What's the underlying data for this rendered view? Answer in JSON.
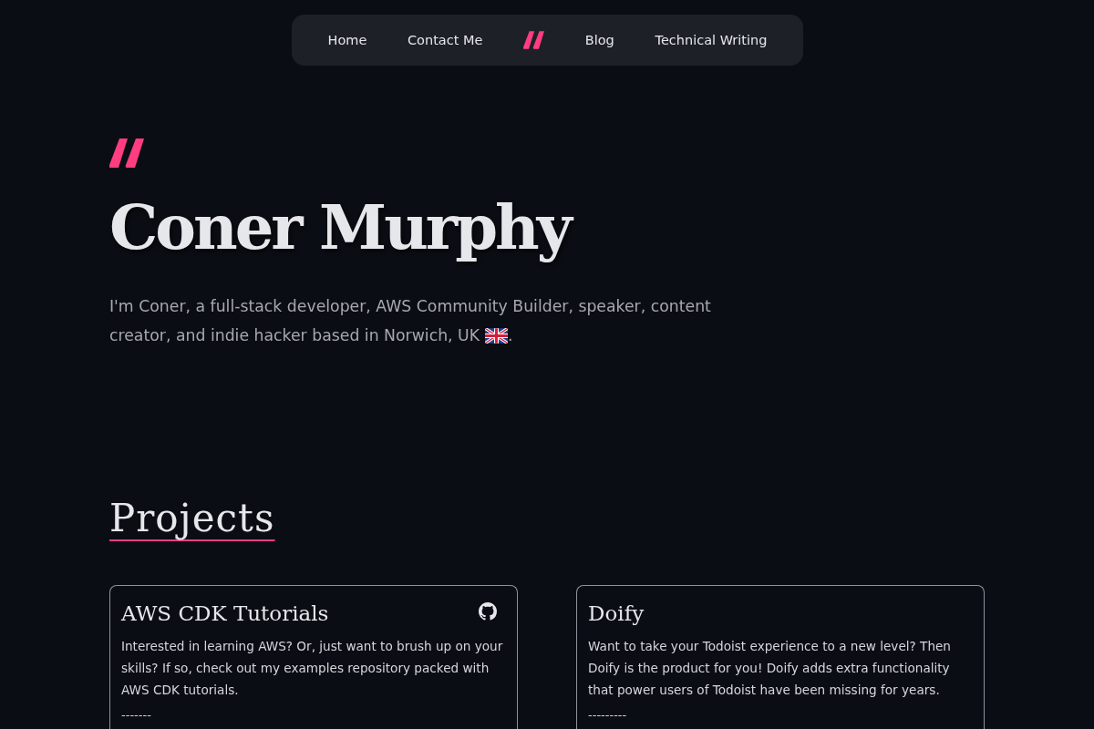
{
  "nav": {
    "links_left": [
      {
        "label": "Home"
      },
      {
        "label": "Contact Me"
      }
    ],
    "links_right": [
      {
        "label": "Blog"
      },
      {
        "label": "Technical Writing"
      }
    ]
  },
  "hero": {
    "name": "Coner Murphy",
    "intro_lines": [
      "I'm Coner, a full-stack developer, AWS Community Builder, speaker, content",
      "creator, and indie hacker based in Norwich, UK"
    ],
    "intro_end": "."
  },
  "projects": {
    "heading": "Projects",
    "items": [
      {
        "title": "AWS CDK Tutorials",
        "github_link": true,
        "description": "Interested in learning AWS? Or, just want to brush up on your skills? If so, check out my examples repository packed with AWS CDK tutorials.",
        "footer": "-------"
      },
      {
        "title": "Doify",
        "github_link": false,
        "description": "Want to take your Todoist experience to a new level? Then Doify is the product for you! Doify adds extra functionality that power users of Todoist have been missing for years.",
        "footer": "---------"
      }
    ]
  }
}
